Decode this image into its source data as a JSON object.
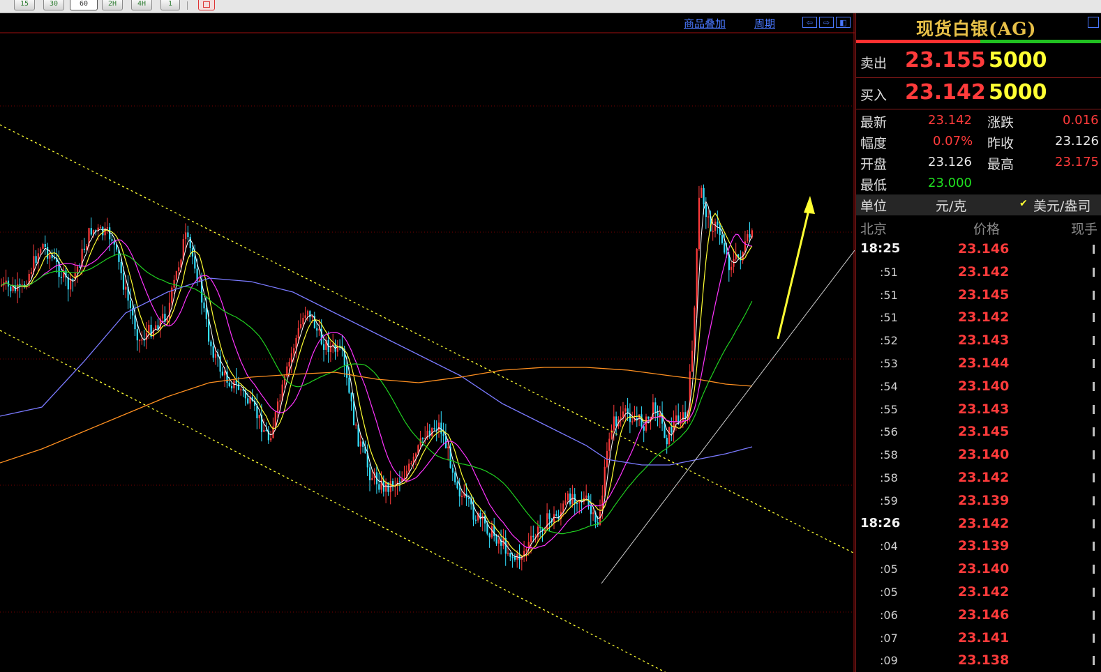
{
  "toolbar": {
    "buttons": [
      "15",
      "30",
      "60",
      "2H",
      "4H",
      "1"
    ],
    "active_button": "60"
  },
  "chart": {
    "overlay_link": "商品叠加",
    "period_link": "周期"
  },
  "quote": {
    "title": "现货白银(AG)",
    "sell_label": "卖出",
    "sell_price": "23.155",
    "sell_volume": "5000",
    "buy_label": "买入",
    "buy_price": "23.142",
    "buy_volume": "5000",
    "stats": {
      "latest_label": "最新",
      "latest": "23.142",
      "change_label": "涨跌",
      "change": "0.016",
      "range_label": "幅度",
      "range": "0.07%",
      "prev_close_label": "昨收",
      "prev_close": "23.126",
      "open_label": "开盘",
      "open": "23.126",
      "high_label": "最高",
      "high": "23.175",
      "low_label": "最低",
      "low": "23.000"
    },
    "unit_label": "单位",
    "unit_value": "元/克",
    "unit_alt": "美元/盎司",
    "col_time": "北京",
    "col_price": "价格",
    "col_volume": "现手",
    "ticks": [
      {
        "time": "18:25",
        "price": "23.146",
        "major": true
      },
      {
        "time": ":51",
        "price": "23.142"
      },
      {
        "time": ":51",
        "price": "23.145"
      },
      {
        "time": ":51",
        "price": "23.142"
      },
      {
        "time": ":52",
        "price": "23.143"
      },
      {
        "time": ":53",
        "price": "23.144"
      },
      {
        "time": ":54",
        "price": "23.140"
      },
      {
        "time": ":55",
        "price": "23.143"
      },
      {
        "time": ":56",
        "price": "23.145"
      },
      {
        "time": ":58",
        "price": "23.140"
      },
      {
        "time": ":58",
        "price": "23.142"
      },
      {
        "time": ":59",
        "price": "23.139"
      },
      {
        "time": "18:26",
        "price": "23.142",
        "major": true
      },
      {
        "time": ":04",
        "price": "23.139"
      },
      {
        "time": ":05",
        "price": "23.140"
      },
      {
        "time": ":05",
        "price": "23.142"
      },
      {
        "time": ":06",
        "price": "23.146"
      },
      {
        "time": ":07",
        "price": "23.141"
      },
      {
        "time": ":09",
        "price": "23.138"
      }
    ]
  },
  "colors": {
    "up": "#ff3b3b",
    "down": "#33e0ff",
    "ma5": "#ffffff",
    "ma10": "#ffff33",
    "ma20": "#ff33ff",
    "ma40": "#20d020",
    "ma60": "#7a7aff",
    "ma120": "#ff9020",
    "channel": "#ffff33",
    "trend": "#d0d0d0",
    "arrow": "#ffff33",
    "grid": "#7a0000"
  }
}
